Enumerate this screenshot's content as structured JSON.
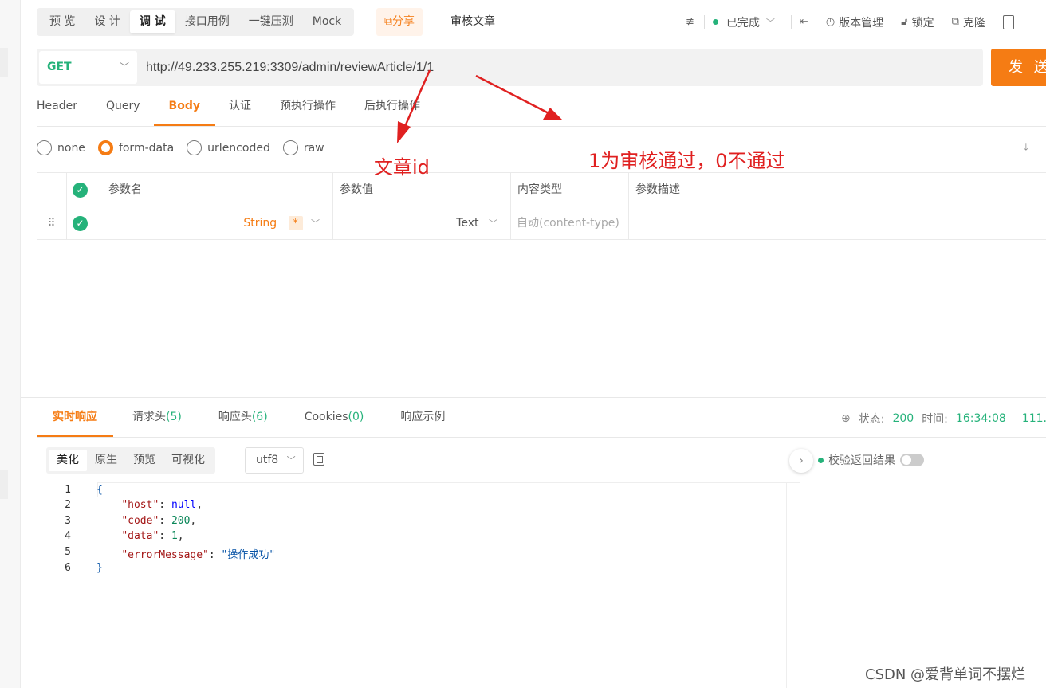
{
  "mode_tabs": [
    "预 览",
    "设 计",
    "调 试",
    "接口用例",
    "一键压测",
    "Mock"
  ],
  "active_mode": "调 试",
  "share_label": "分享",
  "doc_title": "审核文章",
  "status_label": "已完成",
  "version_label": "版本管理",
  "lock_label": "锁定",
  "clone_label": "克隆",
  "method": "GET",
  "url": "http://49.233.255.219:3309/admin/reviewArticle/1/1",
  "send_label": "发 送",
  "request_tabs": [
    "Header",
    "Query",
    "Body",
    "认证",
    "预执行操作",
    "后执行操作"
  ],
  "active_request_tab": "Body",
  "body_types": [
    "none",
    "form-data",
    "urlencoded",
    "raw"
  ],
  "active_body_type": "form-data",
  "params_table": {
    "headers": [
      "参数名",
      "参数值",
      "内容类型",
      "参数描述"
    ],
    "row": {
      "type": "String",
      "required": "*",
      "value_type": "Text",
      "content_type_placeholder": "自动(content-type)"
    }
  },
  "annotations": {
    "article_id": "文章id",
    "review_note": "1为审核通过，0不通过"
  },
  "response_tabs": [
    {
      "label": "实时响应",
      "count": ""
    },
    {
      "label": "请求头",
      "count": "(5)"
    },
    {
      "label": "响应头",
      "count": "(6)"
    },
    {
      "label": "Cookies",
      "count": "(0)"
    },
    {
      "label": "响应示例",
      "count": ""
    }
  ],
  "active_response_tab": "实时响应",
  "response_status": {
    "status_label": "状态:",
    "status": "200",
    "time_label": "时间:",
    "time": "16:34:08",
    "extra": "111."
  },
  "format_tabs": [
    "美化",
    "原生",
    "预览",
    "可视化"
  ],
  "active_format": "美化",
  "encoding": "utf8",
  "validate_label": "校验返回结果",
  "code_lines": [
    "1",
    "2",
    "3",
    "4",
    "5",
    "6"
  ],
  "response_json": {
    "open": "{",
    "host_key": "\"host\"",
    "host_val": "null",
    "code_key": "\"code\"",
    "code_val": "200",
    "data_key": "\"data\"",
    "data_val": "1",
    "msg_key": "\"errorMessage\"",
    "msg_val": "\"操作成功\"",
    "close": "}"
  },
  "watermark": "CSDN @爱背单词不摆烂",
  "colors": {
    "accent": "#f57c14",
    "success": "#25b27a",
    "annotation": "#e02020"
  }
}
